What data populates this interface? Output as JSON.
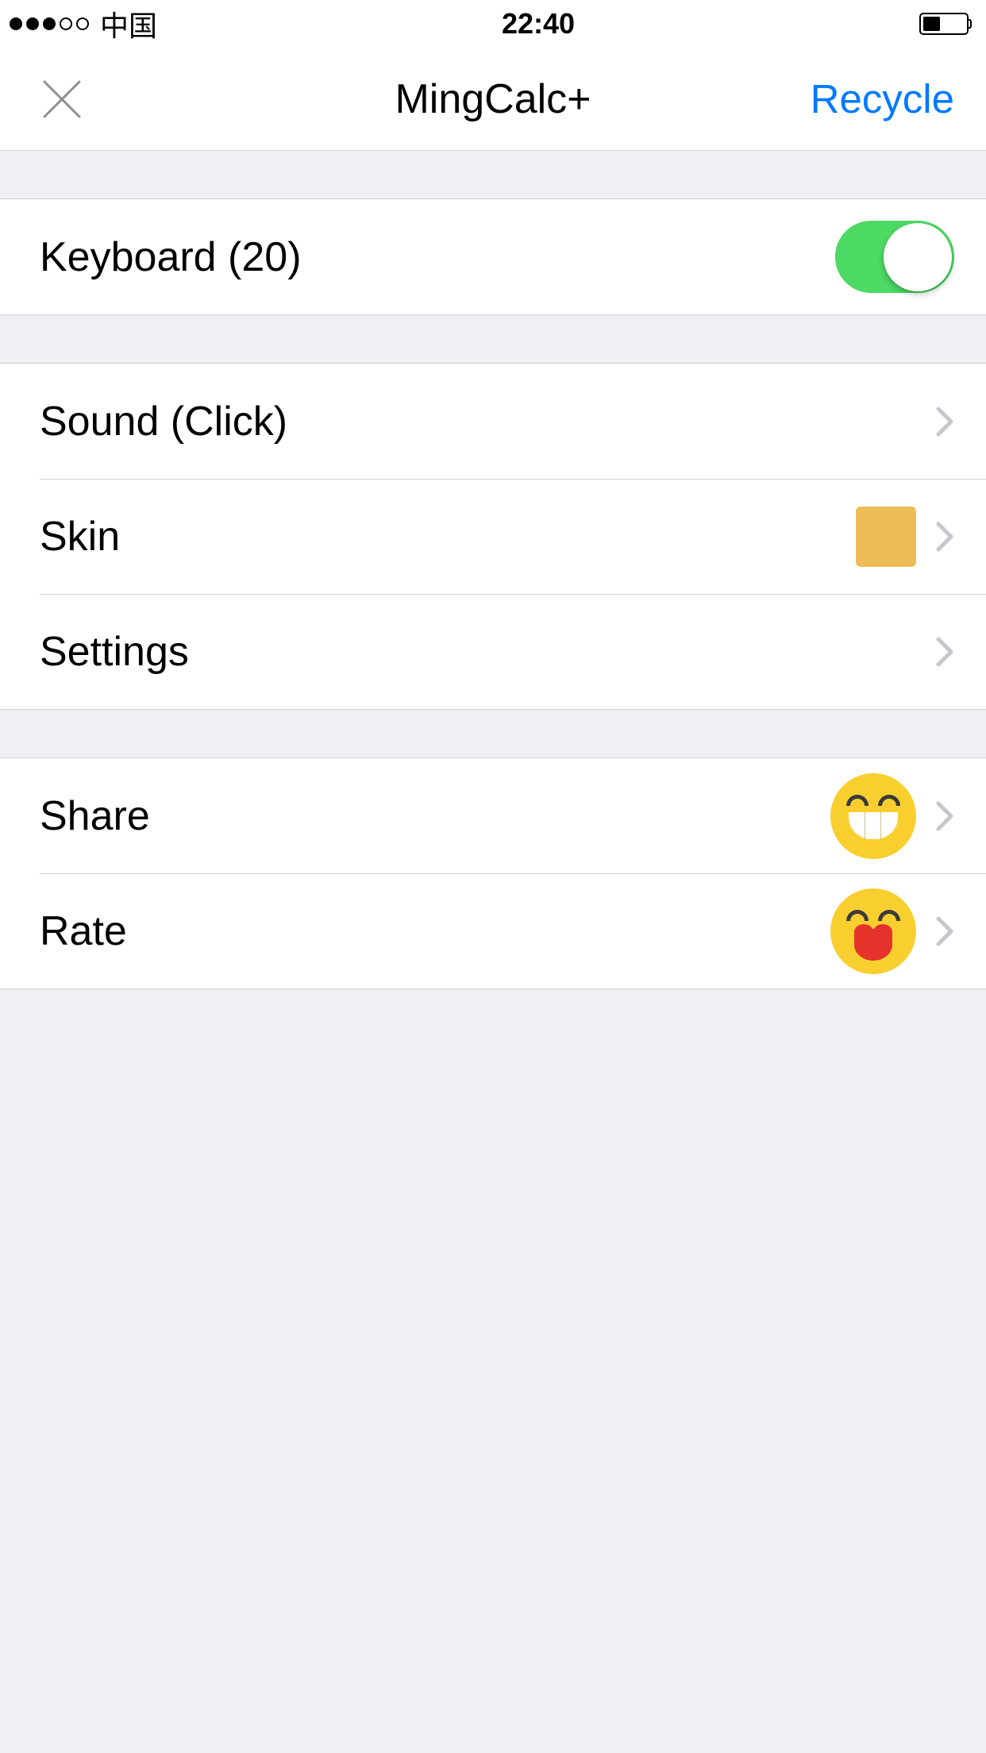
{
  "status": {
    "carrier": "中国",
    "time": "22:40"
  },
  "nav": {
    "title": "MingCalc+",
    "action_label": "Recycle"
  },
  "sections": {
    "keyboard": {
      "label": "Keyboard (20)",
      "enabled": true
    },
    "prefs": {
      "sound_label": "Sound (Click)",
      "skin_label": "Skin",
      "skin_color": "#eebc57",
      "settings_label": "Settings"
    },
    "social": {
      "share_label": "Share",
      "rate_label": "Rate"
    }
  }
}
